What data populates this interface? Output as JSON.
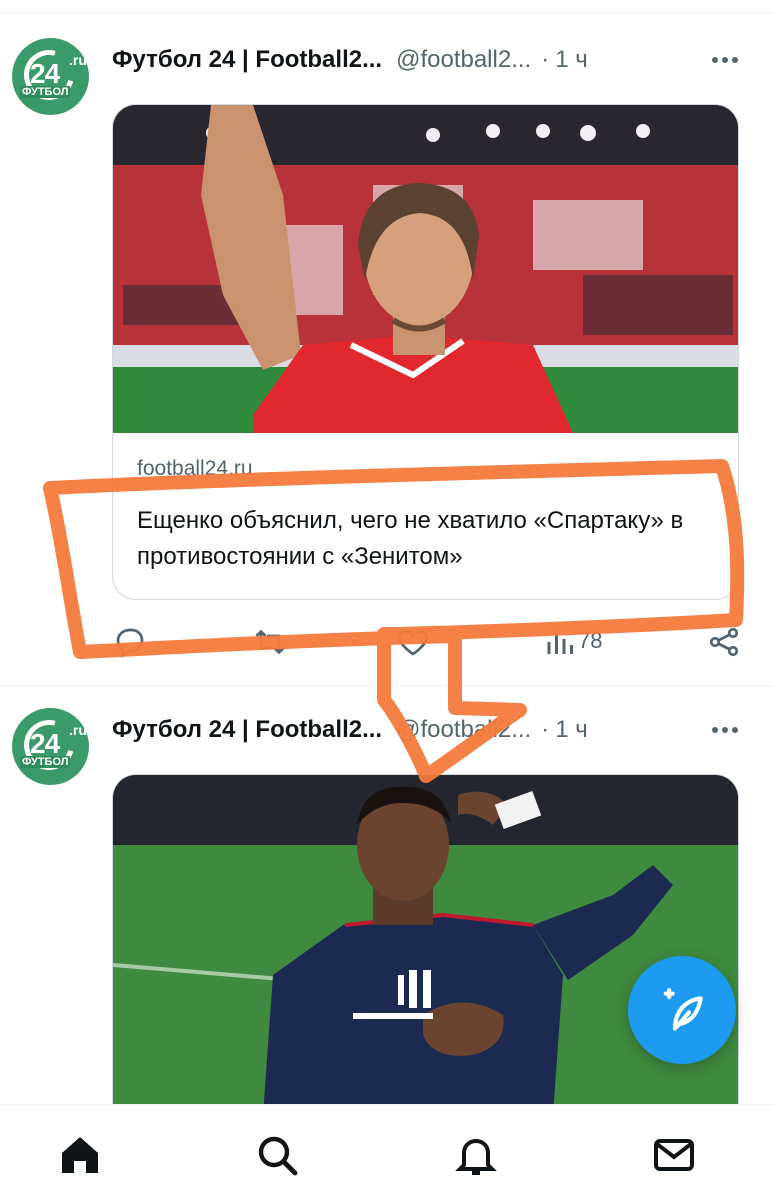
{
  "feed": {
    "tweets": [
      {
        "author_name": "Футбол 24 | Football2...",
        "author_handle": "@football2...",
        "separator": "·",
        "time": "1 ч",
        "avatar": {
          "number": "24",
          "suffix": ".ru",
          "word": "ФУТБОЛ"
        },
        "card": {
          "domain": "football24.ru",
          "title": "Ещенко объяснил, чего не хватило «Спартаку» в противостоянии с «Зенитом»"
        },
        "actions": {
          "views": "78"
        }
      },
      {
        "author_name": "Футбол 24 | Football2...",
        "author_handle": "@football2...",
        "separator": "·",
        "time": "1 ч",
        "avatar": {
          "number": "24",
          "suffix": ".ru",
          "word": "ФУТБОЛ"
        }
      }
    ]
  },
  "icons": {
    "more": "more-dots-icon",
    "reply": "reply-icon",
    "retweet": "retweet-icon",
    "like": "heart-icon",
    "views": "views-icon",
    "share": "share-icon",
    "compose": "compose-tweet-icon",
    "nav": [
      "home-icon",
      "search-icon",
      "notifications-icon",
      "messages-icon"
    ]
  },
  "colors": {
    "accent": "#1d9bf0",
    "avatar_bg": "#3a9a6a",
    "annotation": "#f47a3c",
    "spartak_red": "#e02b2b",
    "psg_navy": "#1c2a52"
  }
}
